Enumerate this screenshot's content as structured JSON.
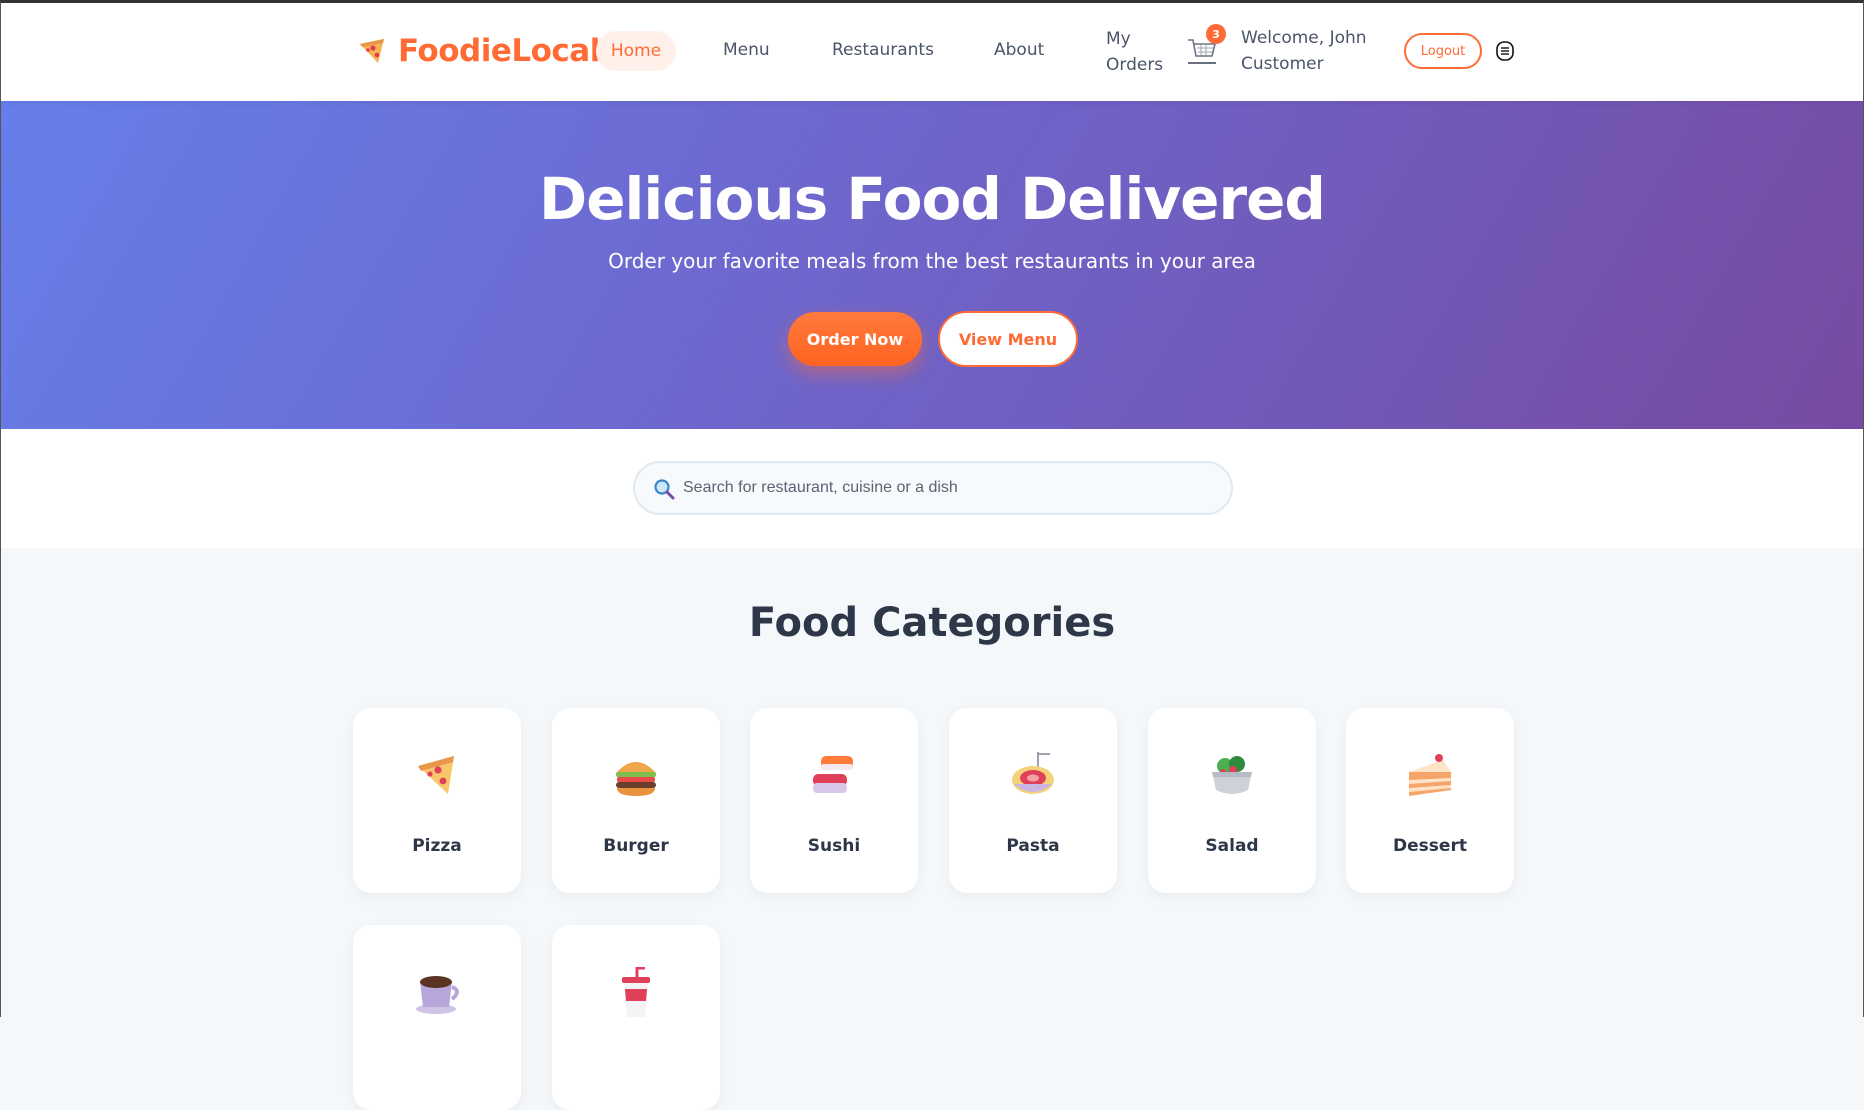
{
  "brand": {
    "name": "FoodieLocal",
    "icon": "pizza-slice-icon",
    "color": "#ff6b35"
  },
  "nav": {
    "home": "Home",
    "menu": "Menu",
    "restaurants": "Restaurants",
    "about": "About",
    "orders_line1": "My",
    "orders_line2": "Orders",
    "cart_count": "3",
    "welcome_line1": "Welcome, John",
    "welcome_line2": "Customer",
    "logout": "Logout"
  },
  "hero": {
    "title": "Delicious Food Delivered",
    "subtitle": "Order your favorite meals from the best restaurants in your area",
    "primary_button": "Order Now",
    "secondary_button": "View Menu",
    "gradient": [
      "#667eea",
      "#764ba2"
    ]
  },
  "search": {
    "placeholder": "Search for restaurant, cuisine or a dish",
    "value": ""
  },
  "categories": {
    "title": "Food Categories",
    "items": [
      {
        "label": "Pizza",
        "icon": "pizza-icon"
      },
      {
        "label": "Burger",
        "icon": "burger-icon"
      },
      {
        "label": "Sushi",
        "icon": "sushi-icon"
      },
      {
        "label": "Pasta",
        "icon": "pasta-icon"
      },
      {
        "label": "Salad",
        "icon": "salad-icon"
      },
      {
        "label": "Dessert",
        "icon": "cake-icon"
      },
      {
        "label": "",
        "icon": "coffee-icon"
      },
      {
        "label": "",
        "icon": "drink-icon"
      }
    ]
  }
}
